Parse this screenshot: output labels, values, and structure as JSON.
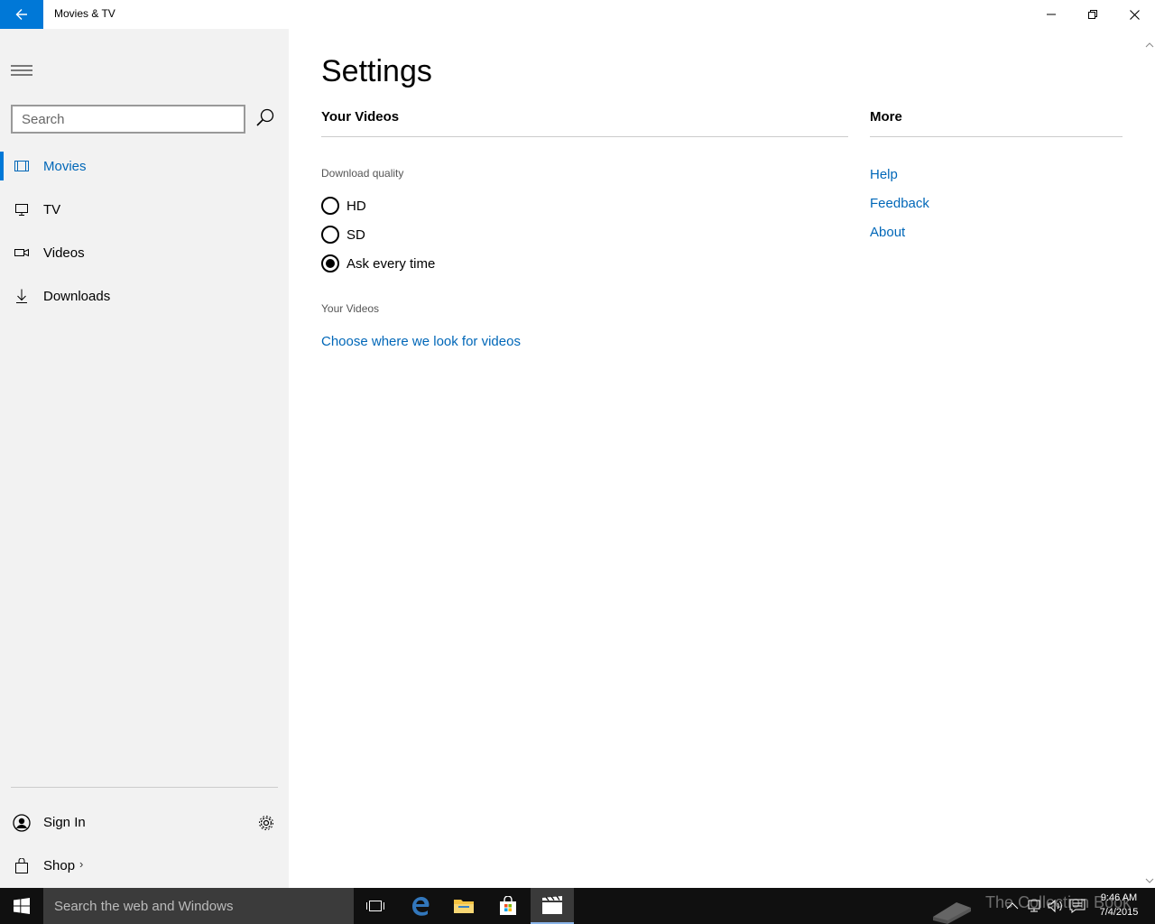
{
  "window": {
    "title": "Movies & TV",
    "back_icon": "back-arrow-icon",
    "controls": [
      "minimize-icon",
      "restore-icon",
      "close-icon"
    ]
  },
  "sidebar": {
    "search_placeholder": "Search",
    "items": [
      {
        "label": "Movies",
        "icon": "film-icon",
        "active": true
      },
      {
        "label": "TV",
        "icon": "tv-icon",
        "active": false
      },
      {
        "label": "Videos",
        "icon": "video-camera-icon",
        "active": false
      },
      {
        "label": "Downloads",
        "icon": "download-icon",
        "active": false
      }
    ],
    "sign_in": "Sign In",
    "shop": "Shop",
    "shop_chevron": "›"
  },
  "settings": {
    "title": "Settings",
    "your_videos_header": "Your Videos",
    "download_quality_label": "Download quality",
    "quality_options": [
      {
        "label": "HD",
        "checked": false
      },
      {
        "label": "SD",
        "checked": false
      },
      {
        "label": "Ask every time",
        "checked": true
      }
    ],
    "your_videos_label": "Your Videos",
    "choose_location_link": "Choose where we look for videos",
    "more_header": "More",
    "more_links": [
      "Help",
      "Feedback",
      "About"
    ]
  },
  "taskbar": {
    "search_text": "Search the web and Windows",
    "watermark": "The Collection Book",
    "time": "9:46 AM",
    "date": "7/4/2015"
  },
  "colors": {
    "accent": "#0078d7",
    "link": "#0067b8",
    "sidebar_bg": "#f2f2f2",
    "taskbar_bg": "#101010"
  }
}
